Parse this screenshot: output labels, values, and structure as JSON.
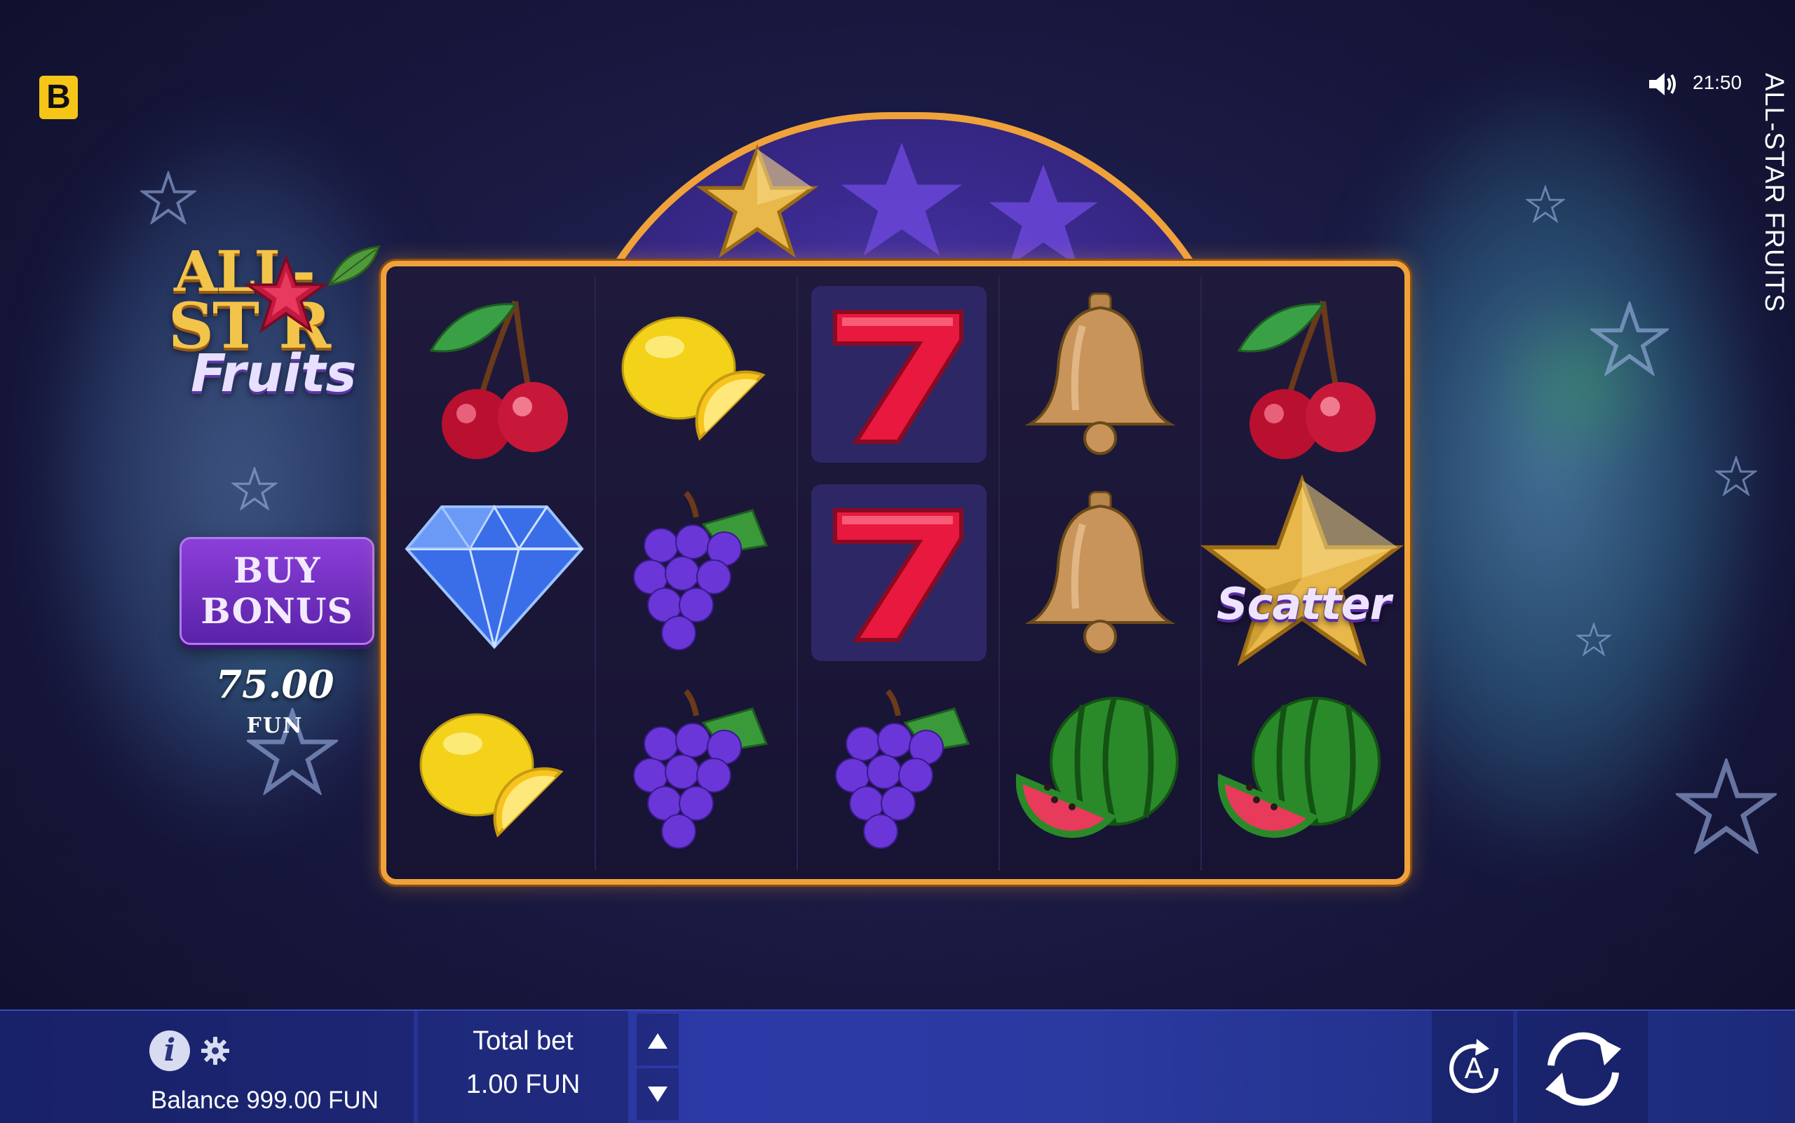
{
  "brand": {
    "badge_letter": "B",
    "badge_color": "#f5c518"
  },
  "status": {
    "time": "21:50",
    "sound_icon": "speaker-icon"
  },
  "game": {
    "title_vertical": "ALL-STAR FRUITS",
    "logo": {
      "line1": "ALL-",
      "line2": "ST R",
      "line3": "Fruits"
    }
  },
  "bonus": {
    "button_line1": "BUY",
    "button_line2": "BONUS",
    "price": "75.00",
    "currency": "FUN",
    "button_color": "#7a35c8"
  },
  "progress_stars": {
    "total": 3,
    "lit": 1
  },
  "reels": {
    "columns": [
      [
        "cherry",
        "diamond",
        "lemon"
      ],
      [
        "lemon",
        "grapes",
        "grapes"
      ],
      [
        "seven",
        "seven",
        "grapes"
      ],
      [
        "bell",
        "bell",
        "watermelon"
      ],
      [
        "cherry",
        "scatter",
        "watermelon"
      ]
    ],
    "scatter_label": "Scatter"
  },
  "bottom_bar": {
    "balance": "Balance 999.00 FUN",
    "total_bet_label": "Total bet",
    "total_bet_value": "1.00 FUN",
    "info_icon_glyph": "i",
    "autoplay_glyph": "A"
  },
  "colors": {
    "frame": "#f0a23a",
    "bar": "#2c3aa8",
    "accent_purple": "#5b3fc8"
  }
}
